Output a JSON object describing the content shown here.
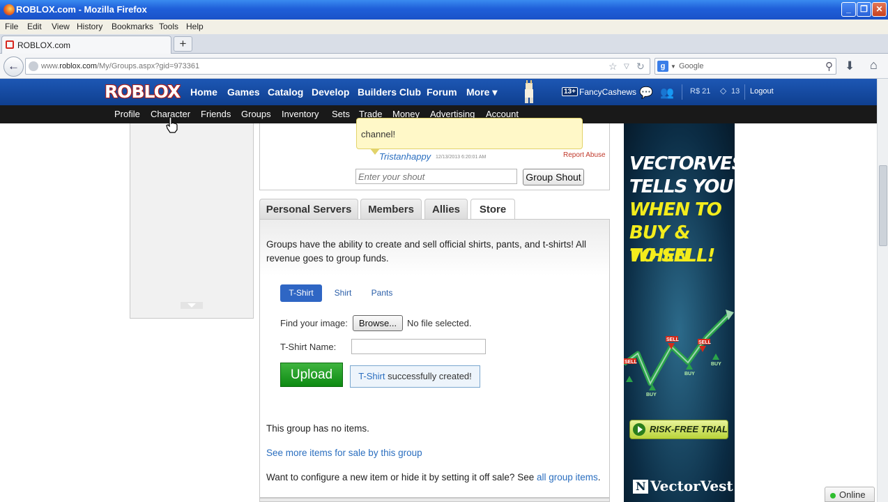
{
  "window": {
    "title": "ROBLOX.com - Mozilla Firefox"
  },
  "menubar": [
    "File",
    "Edit",
    "View",
    "History",
    "Bookmarks",
    "Tools",
    "Help"
  ],
  "tab": {
    "label": "ROBLOX.com",
    "new_tab": "+"
  },
  "urlbar": {
    "prefix": "www.",
    "domain": "roblox.com",
    "path": "/My/Groups.aspx?gid=973361"
  },
  "searchbar": {
    "engine_letter": "g",
    "placeholder": "Google"
  },
  "roblox": {
    "logo": "ROBLOX",
    "nav": [
      "Home",
      "Games",
      "Catalog",
      "Develop",
      "Builders Club",
      "Forum",
      "More ▾"
    ],
    "age_badge": "13+",
    "username": "FancyCashews",
    "robux": "R$ 21",
    "tickets": "13",
    "logout": "Logout",
    "subnav": [
      "Profile",
      "Character",
      "Friends",
      "Groups",
      "Inventory",
      "Sets",
      "Trade",
      "Money",
      "Advertising",
      "Account"
    ]
  },
  "shout": {
    "text": "channel!",
    "user": "Tristanhappy",
    "time": "12/13/2013 6:20:01 AM",
    "report": "Report Abuse",
    "input_placeholder": "Enter your shout",
    "button": "Group Shout"
  },
  "group_tabs": [
    "Personal Servers",
    "Members",
    "Allies",
    "Store"
  ],
  "store": {
    "description": "Groups have the ability to create and sell official shirts, pants, and t-shirts! All revenue goes to group funds.",
    "types": [
      "T-Shirt",
      "Shirt",
      "Pants"
    ],
    "find_label": "Find your image:",
    "browse": "Browse...",
    "no_file": "No file selected.",
    "name_label": "T-Shirt Name:",
    "upload": "Upload",
    "success_highlight": "T-Shirt",
    "success_rest": " successfully created!",
    "no_items": "This group has no items.",
    "see_more": "See more items for sale by this group",
    "configure_text": "Want to configure a new item or hide it by setting it off sale? See ",
    "configure_link": "all group items",
    "configure_end": "."
  },
  "ad": {
    "lines": [
      {
        "text": "VECTORVEST",
        "color": "#ffffff"
      },
      {
        "text": "TELLS YOU",
        "color": "#ffffff"
      },
      {
        "text": "WHEN TO",
        "color": "#f3ec1c"
      },
      {
        "text": "BUY & WHEN",
        "color": "#f3ec1c"
      },
      {
        "text": "TO SELL!",
        "color": "#f3ec1c"
      }
    ],
    "sell_label": "SELL",
    "buy_label": "BUY",
    "cta": "RISK-FREE TRIAL",
    "brand": "VectorVest"
  },
  "status": {
    "online": "Online"
  }
}
